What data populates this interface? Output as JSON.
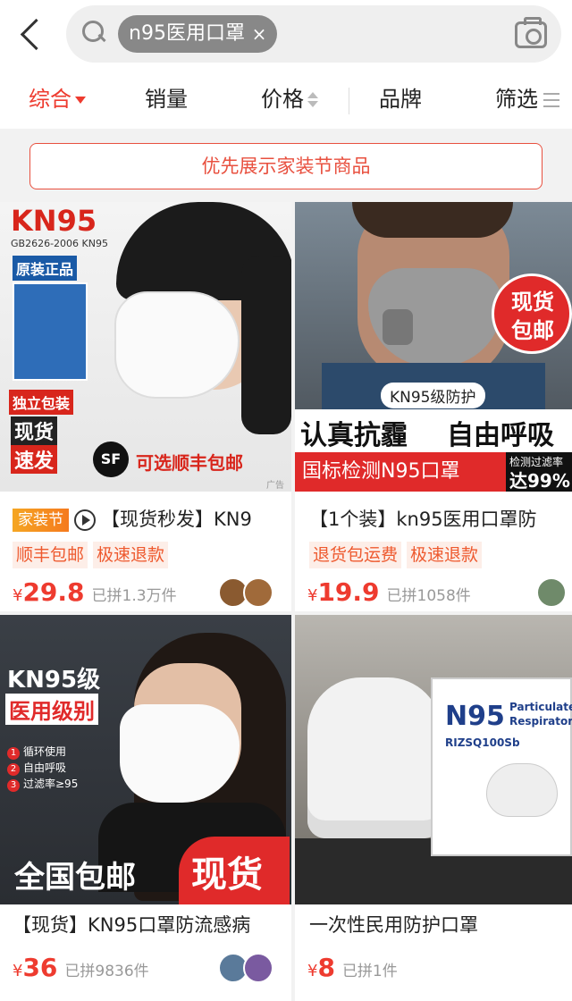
{
  "search": {
    "query_chip": "n95医用口罩",
    "chip_close": "×"
  },
  "sort_tabs": [
    {
      "label": "综合",
      "active": true
    },
    {
      "label": "销量",
      "active": false
    },
    {
      "label": "价格",
      "active": false
    },
    {
      "label": "品牌",
      "active": false
    },
    {
      "label": "筛选",
      "active": false
    }
  ],
  "banner": "优先展示家装节商品",
  "products": [
    {
      "image_text": {
        "brand": "KN95",
        "standard": "GB2626-2006 KN95",
        "badge1": "原装正品",
        "badge2": "独立包装",
        "badge3a": "现货",
        "badge3b": "速发",
        "sf_logo": "SF",
        "sf_text": "可选顺丰包邮",
        "ad": "广告"
      },
      "festival_badge": "家装节",
      "title": "【现货秒发】KN9",
      "tags": [
        "顺丰包邮",
        "极速退款"
      ],
      "currency": "¥",
      "price": "29.8",
      "sold": "已拼1.3万件"
    },
    {
      "image_text": {
        "stamp1": "现货",
        "stamp2": "包邮",
        "grade": "KN95级防护",
        "slogan_left": "认真抗霾",
        "slogan_right": "自由呼吸",
        "red_bar": "国标检测N95口罩",
        "filter_label": "检测过滤率",
        "filter_value": "达99%"
      },
      "title": "【1个装】kn95医用口罩防",
      "tags": [
        "退货包运费",
        "极速退款"
      ],
      "currency": "¥",
      "price": "19.9",
      "sold": "已拼1058件"
    },
    {
      "image_text": {
        "level": "KN95级",
        "medical": "医用级别",
        "f1": "循环使用",
        "f2": "自由呼吸",
        "f3": "过滤率≥95",
        "bottom_left": "全国包邮",
        "bottom_right": "现货"
      },
      "title": "【现货】KN95口罩防流感病",
      "currency": "¥",
      "price": "36",
      "sold": "已拼9836件"
    },
    {
      "image_text": {
        "box_brand": "N95",
        "box_sub1": "Particulate",
        "box_sub2": "Respirator",
        "box_model": "RIZSQ100Sb"
      },
      "title": "一次性民用防护口罩",
      "currency": "¥",
      "price": "8",
      "sold": "已拼1件"
    }
  ]
}
